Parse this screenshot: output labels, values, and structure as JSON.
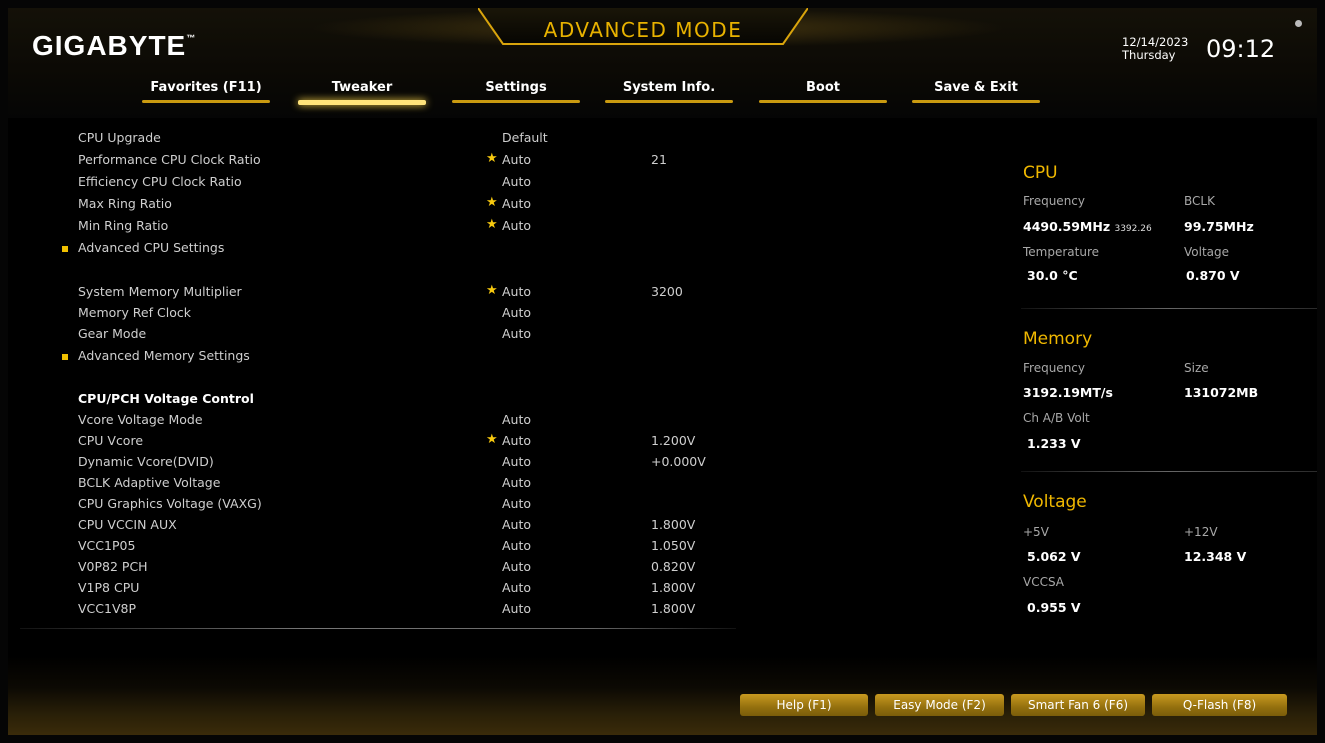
{
  "header": {
    "brand": "GIGABYTE",
    "brand_tm": "™",
    "mode_title": "ADVANCED MODE",
    "date": "12/14/2023",
    "weekday": "Thursday",
    "time": "09:12"
  },
  "tabs": [
    {
      "label": "Favorites (F11)",
      "active": false
    },
    {
      "label": "Tweaker",
      "active": true
    },
    {
      "label": "Settings",
      "active": false
    },
    {
      "label": "System Info.",
      "active": false
    },
    {
      "label": "Boot",
      "active": false
    },
    {
      "label": "Save & Exit",
      "active": false
    }
  ],
  "settings": [
    {
      "label": "CPU Upgrade",
      "value": "Default",
      "value2": "",
      "star": false,
      "submenu": false,
      "heading": false
    },
    {
      "label": "Performance CPU Clock Ratio",
      "value": "Auto",
      "value2": "21",
      "star": true,
      "submenu": false,
      "heading": false
    },
    {
      "label": "Efficiency CPU Clock Ratio",
      "value": "Auto",
      "value2": "",
      "star": false,
      "submenu": false,
      "heading": false
    },
    {
      "label": "Max Ring Ratio",
      "value": "Auto",
      "value2": "",
      "star": true,
      "submenu": false,
      "heading": false
    },
    {
      "label": "Min Ring Ratio",
      "value": "Auto",
      "value2": "",
      "star": true,
      "submenu": false,
      "heading": false
    },
    {
      "label": "Advanced CPU Settings",
      "value": "",
      "value2": "",
      "star": false,
      "submenu": true,
      "heading": false
    },
    {
      "label": "System Memory Multiplier",
      "value": "Auto",
      "value2": "3200",
      "star": true,
      "submenu": false,
      "heading": false
    },
    {
      "label": "Memory Ref Clock",
      "value": "Auto",
      "value2": "",
      "star": false,
      "submenu": false,
      "heading": false
    },
    {
      "label": "Gear Mode",
      "value": "Auto",
      "value2": "",
      "star": false,
      "submenu": false,
      "heading": false
    },
    {
      "label": "Advanced Memory Settings",
      "value": "",
      "value2": "",
      "star": false,
      "submenu": true,
      "heading": false
    },
    {
      "label": "CPU/PCH Voltage Control",
      "value": "",
      "value2": "",
      "star": false,
      "submenu": false,
      "heading": true
    },
    {
      "label": "Vcore Voltage Mode",
      "value": "Auto",
      "value2": "",
      "star": false,
      "submenu": false,
      "heading": false
    },
    {
      "label": "CPU Vcore",
      "value": "Auto",
      "value2": "1.200V",
      "star": true,
      "submenu": false,
      "heading": false
    },
    {
      "label": "Dynamic Vcore(DVID)",
      "value": "Auto",
      "value2": "+0.000V",
      "star": false,
      "submenu": false,
      "heading": false
    },
    {
      "label": "BCLK Adaptive Voltage",
      "value": "Auto",
      "value2": "",
      "star": false,
      "submenu": false,
      "heading": false
    },
    {
      "label": "CPU Graphics Voltage (VAXG)",
      "value": "Auto",
      "value2": "",
      "star": false,
      "submenu": false,
      "heading": false
    },
    {
      "label": "CPU VCCIN AUX",
      "value": "Auto",
      "value2": "1.800V",
      "star": false,
      "submenu": false,
      "heading": false
    },
    {
      "label": "VCC1P05",
      "value": "Auto",
      "value2": "1.050V",
      "star": false,
      "submenu": false,
      "heading": false
    },
    {
      "label": "V0P82 PCH",
      "value": "Auto",
      "value2": "0.820V",
      "star": false,
      "submenu": false,
      "heading": false
    },
    {
      "label": "V1P8 CPU",
      "value": "Auto",
      "value2": "1.800V",
      "star": false,
      "submenu": false,
      "heading": false
    },
    {
      "label": "VCC1V8P",
      "value": "Auto",
      "value2": "1.800V",
      "star": false,
      "submenu": false,
      "heading": false
    }
  ],
  "monitor": {
    "cpu": {
      "title": "CPU",
      "freq_label": "Frequency",
      "freq_value": "4490.59MHz",
      "freq_sub": "3392.26",
      "bclk_label": "BCLK",
      "bclk_value": "99.75MHz",
      "temp_label": "Temperature",
      "temp_value": "30.0 °C",
      "volt_label": "Voltage",
      "volt_value": "0.870 V"
    },
    "memory": {
      "title": "Memory",
      "freq_label": "Frequency",
      "freq_value": "3192.19MT/s",
      "size_label": "Size",
      "size_value": "131072MB",
      "chvolt_label": "Ch A/B Volt",
      "chvolt_value": "1.233 V"
    },
    "voltage": {
      "title": "Voltage",
      "v5_label": "+5V",
      "v5_value": "5.062 V",
      "v12_label": "+12V",
      "v12_value": "12.348 V",
      "vccsa_label": "VCCSA",
      "vccsa_value": "0.955 V"
    }
  },
  "footer_buttons": [
    {
      "label": "Help (F1)"
    },
    {
      "label": "Easy Mode (F2)"
    },
    {
      "label": "Smart Fan 6 (F6)"
    },
    {
      "label": "Q-Flash (F8)"
    }
  ],
  "colors": {
    "accent": "#f0b800",
    "star": "#f7c90f",
    "button": "#a47d14",
    "background": "#000000"
  }
}
